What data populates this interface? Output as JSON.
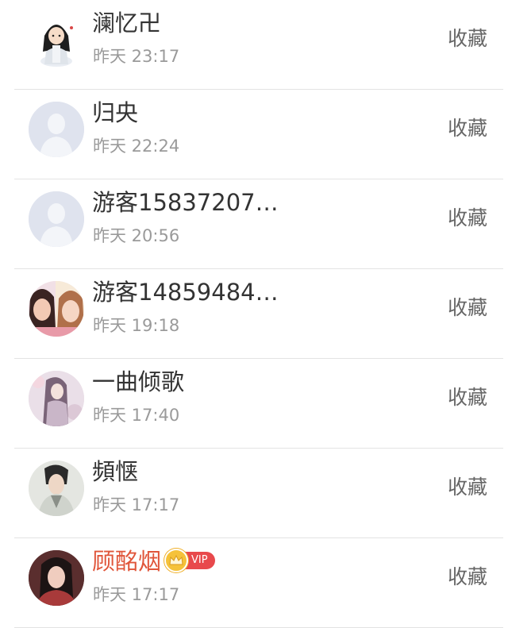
{
  "action_label": "收藏",
  "rows": [
    {
      "name": "澜忆卍",
      "time": "昨天 23:17",
      "avatar": "pixel-girl-avatar"
    },
    {
      "name": "归央",
      "time": "昨天 22:24",
      "avatar": "default-avatar"
    },
    {
      "name": "游客15837207…",
      "time": "昨天 20:56",
      "avatar": "default-avatar"
    },
    {
      "name": "游客14859484…",
      "time": "昨天 19:18",
      "avatar": "two-girls-avatar"
    },
    {
      "name": "一曲倾歌",
      "time": "昨天 17:40",
      "avatar": "illustrated-girl-avatar"
    },
    {
      "name": "頻惬",
      "time": "昨天 17:17",
      "avatar": "man-portrait-avatar"
    },
    {
      "name": "顾酩烟",
      "time": "昨天 17:17",
      "avatar": "woman-portrait-avatar",
      "vip": true,
      "vip_label": "VIP"
    }
  ],
  "colors": {
    "vip_name": "#e0553a",
    "vip_tag": "#e8494c",
    "crown": "#f5c23a"
  }
}
